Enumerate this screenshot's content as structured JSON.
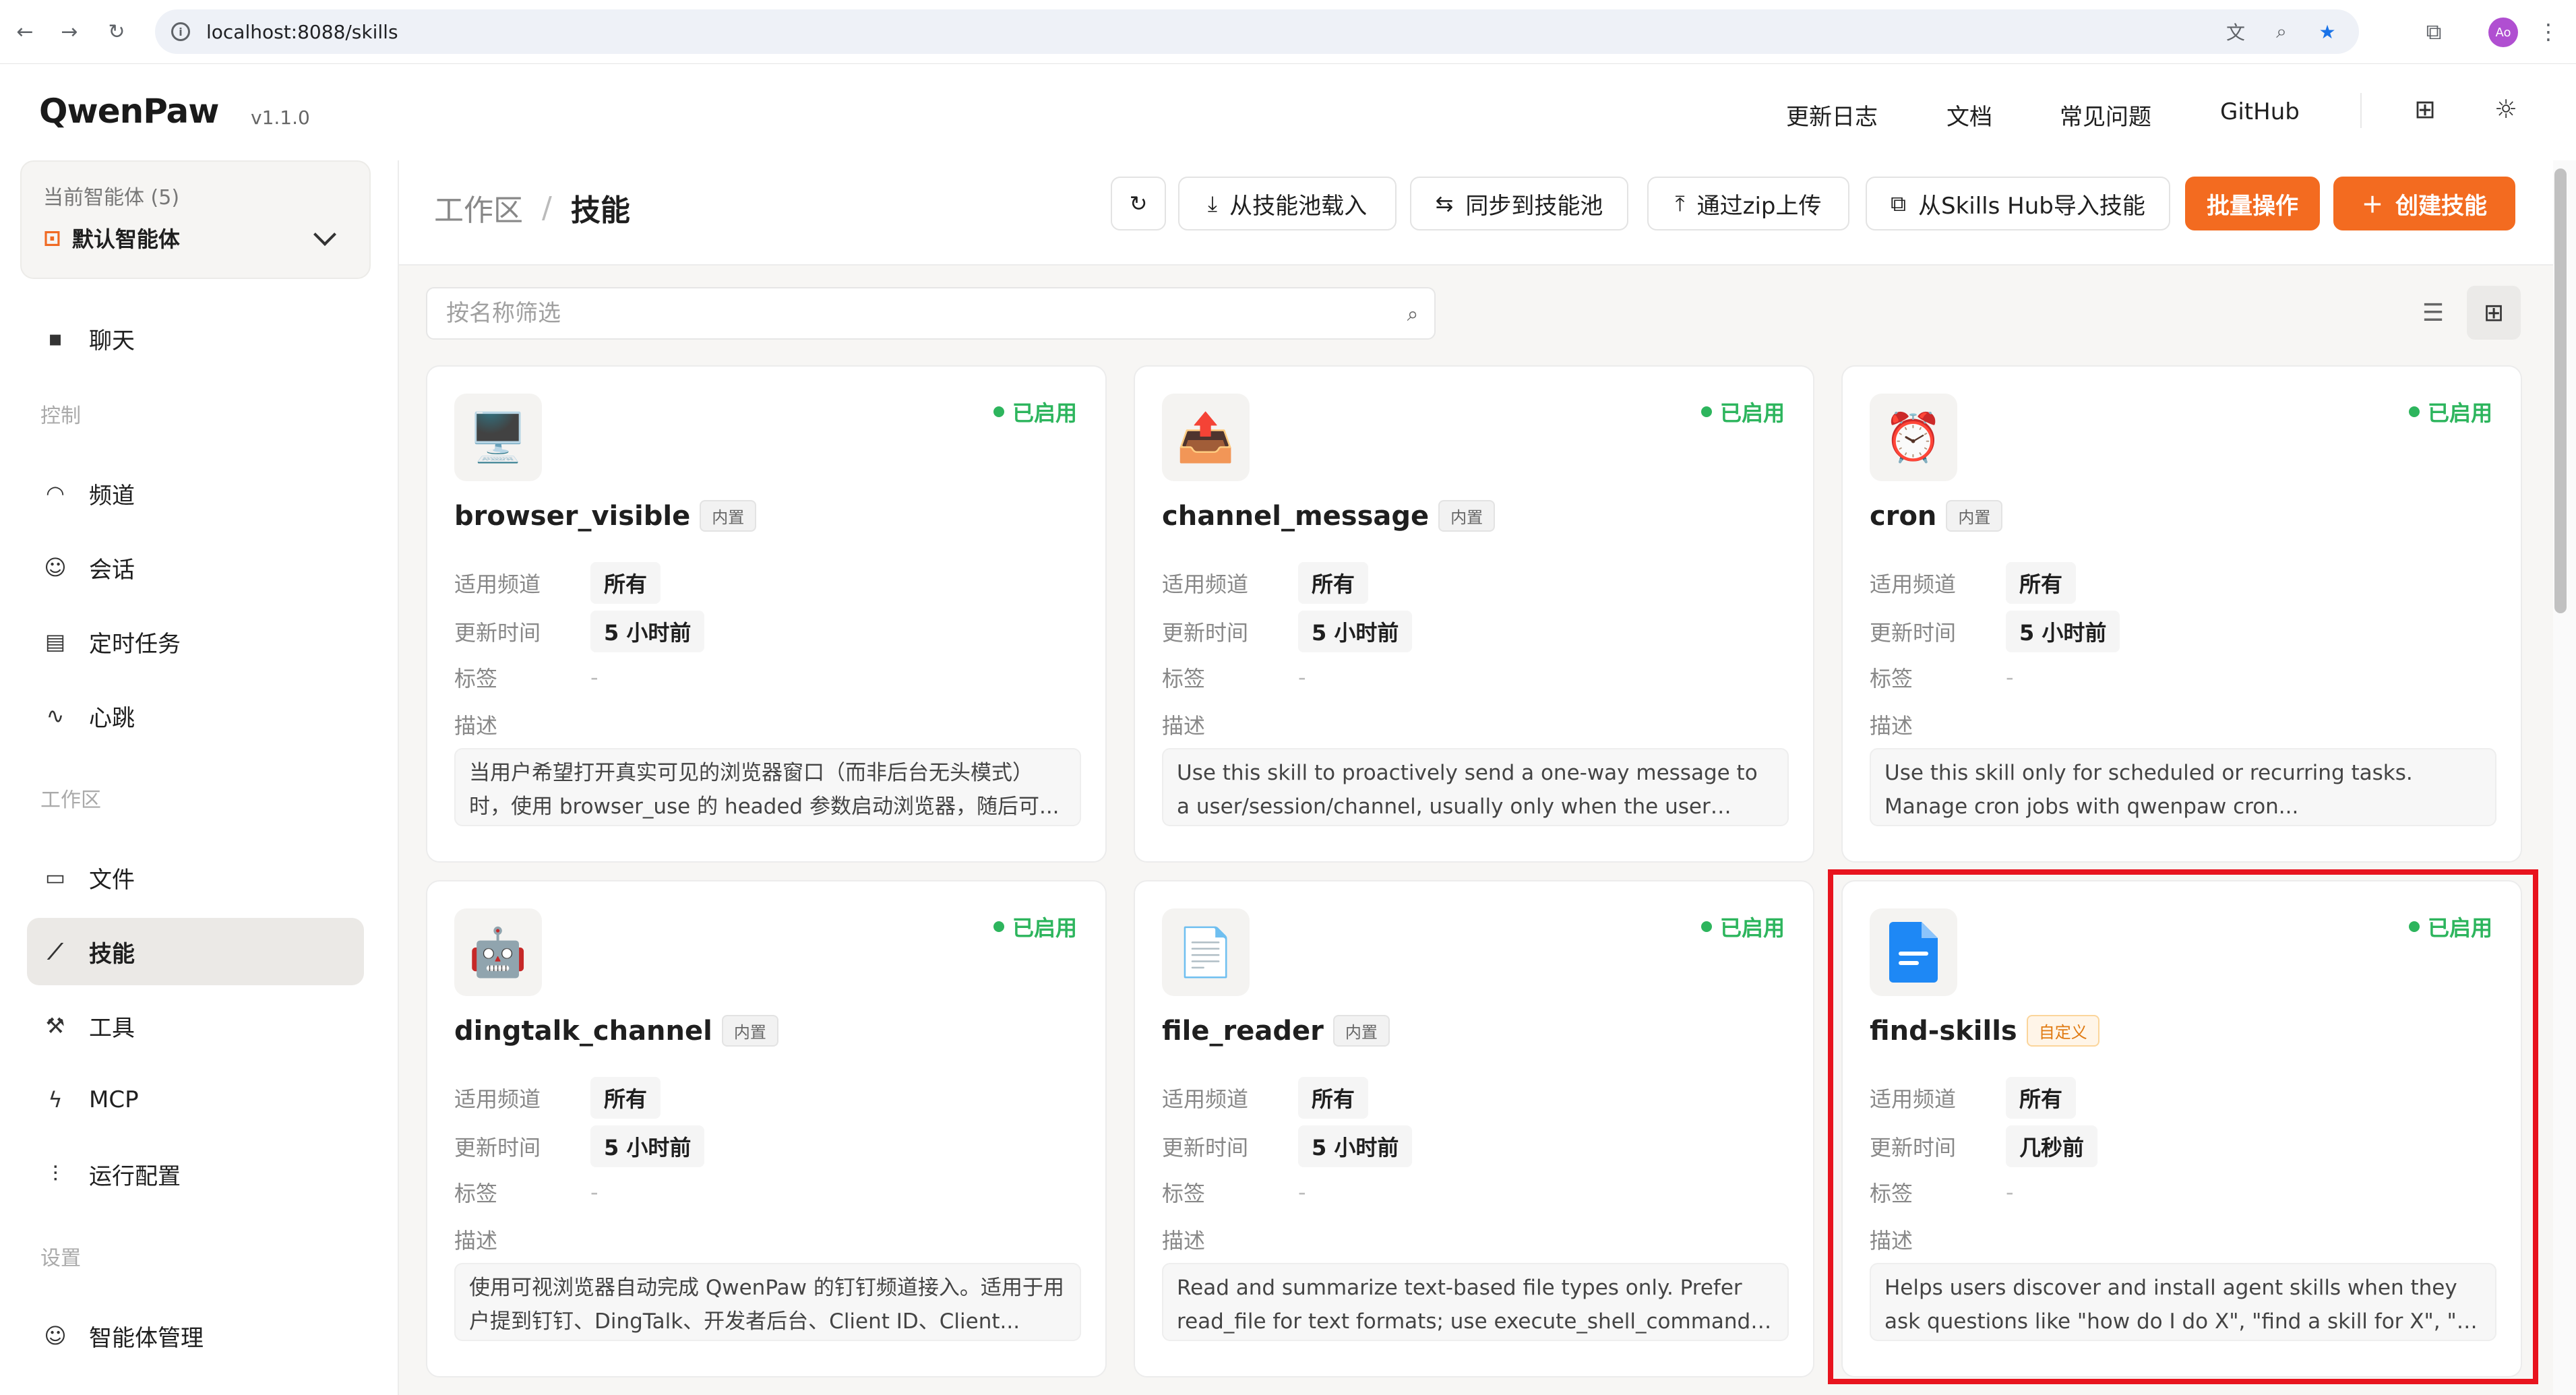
{
  "browser": {
    "url": "localhost:8088/skills",
    "profile_initials": "Ao"
  },
  "app": {
    "brand": "QwenPaw",
    "version": "v1.1.0",
    "top_links": [
      "更新日志",
      "文档",
      "常见问题",
      "GitHub"
    ]
  },
  "sidebar": {
    "agent_label": "当前智能体 (5)",
    "agent_current": "默认智能体",
    "chat": "聊天",
    "group_control": "控制",
    "channels": "频道",
    "sessions": "会话",
    "cron": "定时任务",
    "heartbeat": "心跳",
    "group_workspace": "工作区",
    "files": "文件",
    "skills": "技能",
    "tools": "工具",
    "mcp": "MCP",
    "runtime": "运行配置",
    "group_settings": "设置",
    "agent_mgmt": "智能体管理"
  },
  "main": {
    "breadcrumb_parent": "工作区",
    "breadcrumb_sep": "/",
    "breadcrumb_current": "技能",
    "toolbar": {
      "load_pool": "从技能池载入",
      "sync_pool": "同步到技能池",
      "zip_upload": "通过zip上传",
      "hub_import": "从Skills Hub导入技能",
      "batch": "批量操作",
      "create": "创建技能"
    },
    "filter_placeholder": "按名称筛选"
  },
  "card_labels": {
    "channel": "适用频道",
    "updated": "更新时间",
    "tags": "标签",
    "desc": "描述"
  },
  "cards": [
    {
      "name": "browser_visible",
      "badge": "内置",
      "status": "已启用",
      "icon": "🖥️",
      "channel": "所有",
      "updated": "5 小时前",
      "tags": "-",
      "desc": "当用户希望打开真实可见的浏览器窗口（而非后台无头模式）时，使用 browser_use 的 headed 参数启动浏览器，随后可..."
    },
    {
      "name": "channel_message",
      "badge": "内置",
      "status": "已启用",
      "icon": "📤",
      "channel": "所有",
      "updated": "5 小时前",
      "tags": "-",
      "desc": "Use this skill to proactively send a one-way message to a user/session/channel, usually only when the user explicitl..."
    },
    {
      "name": "cron",
      "badge": "内置",
      "status": "已启用",
      "icon": "⏰",
      "channel": "所有",
      "updated": "5 小时前",
      "tags": "-",
      "desc": "Use this skill only for scheduled or recurring tasks. Manage cron jobs with qwenpaw cron..."
    },
    {
      "name": "dingtalk_channel",
      "badge": "内置",
      "status": "已启用",
      "icon": "🤖",
      "channel": "所有",
      "updated": "5 小时前",
      "tags": "-",
      "desc": "使用可视浏览器自动完成 QwenPaw 的钉钉频道接入。适用于用户提到钉钉、DingTalk、开发者后台、Client ID、Client..."
    },
    {
      "name": "file_reader",
      "badge": "内置",
      "status": "已启用",
      "icon": "📄",
      "channel": "所有",
      "updated": "5 小时前",
      "tags": "-",
      "desc": "Read and summarize text-based file types only. Prefer read_file for text formats; use execute_shell_command fo..."
    },
    {
      "name": "find-skills",
      "badge": "自定义",
      "status": "已启用",
      "icon": "📘",
      "channel": "所有",
      "updated": "几秒前",
      "tags": "-",
      "desc": "Helps users discover and install agent skills when they ask questions like \"how do I do X\", \"find a skill for X\", \"is ther..."
    }
  ],
  "colors": {
    "accent": "#f36b20",
    "enabled": "#2db55d",
    "highlight": "#e8141e",
    "custom_badge": "#e07a12"
  }
}
